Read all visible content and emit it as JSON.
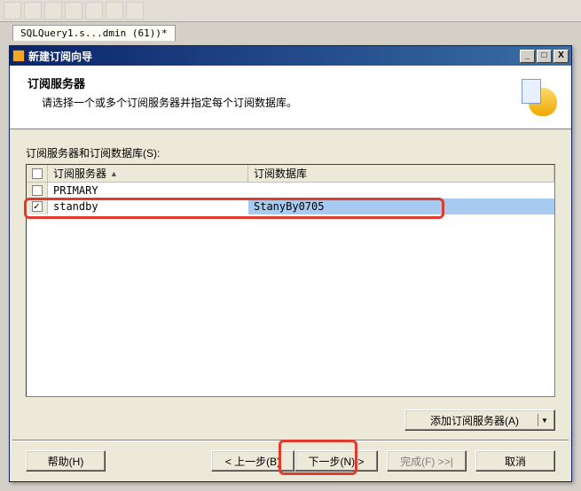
{
  "background": {
    "tab_label": "SQLQuery1.s...dmin (61))*"
  },
  "window": {
    "title": "新建订阅向导",
    "minimize": "_",
    "maximize": "□",
    "close": "X"
  },
  "header": {
    "title": "订阅服务器",
    "subtitle": "请选择一个或多个订阅服务器并指定每个订阅数据库。"
  },
  "body": {
    "label": "订阅服务器和订阅数据库(S):",
    "columns": {
      "server": "订阅服务器",
      "database": "订阅数据库"
    },
    "rows": [
      {
        "checked": false,
        "server": "PRIMARY",
        "database": ""
      },
      {
        "checked": true,
        "server": "standby",
        "database": "StanyBy0705"
      }
    ],
    "sort_indicator": "▲",
    "add_button": "添加订阅服务器(A)"
  },
  "footer": {
    "help": "帮助(H)",
    "back": "< 上一步(B)",
    "next": "下一步(N) >",
    "finish": "完成(F) >>|",
    "cancel": "取消"
  },
  "checkmark": "✓",
  "dropdown_arrow": "▼"
}
